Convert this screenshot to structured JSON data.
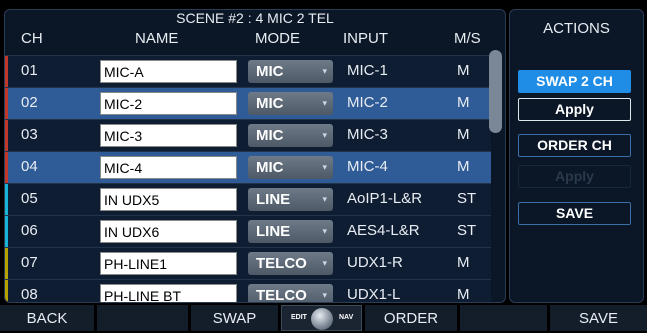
{
  "scene": {
    "title": "SCENE #2 : 4 MIC 2 TEL"
  },
  "columns": {
    "ch": "CH",
    "name": "NAME",
    "mode": "MODE",
    "input": "INPUT",
    "ms": "M/S"
  },
  "rows": [
    {
      "ch": "01",
      "name": "MIC-A",
      "mode": "MIC",
      "input": "MIC-1",
      "ms": "M",
      "selected": false,
      "stripe": "#c0392b"
    },
    {
      "ch": "02",
      "name": "MIC-2",
      "mode": "MIC",
      "input": "MIC-2",
      "ms": "M",
      "selected": true,
      "stripe": "#c0392b"
    },
    {
      "ch": "03",
      "name": "MIC-3",
      "mode": "MIC",
      "input": "MIC-3",
      "ms": "M",
      "selected": false,
      "stripe": "#c0392b"
    },
    {
      "ch": "04",
      "name": "MIC-4",
      "mode": "MIC",
      "input": "MIC-4",
      "ms": "M",
      "selected": true,
      "stripe": "#c0392b"
    },
    {
      "ch": "05",
      "name": "IN UDX5",
      "mode": "LINE",
      "input": "AoIP1-L&R",
      "ms": "ST",
      "selected": false,
      "stripe": "#17b3d6"
    },
    {
      "ch": "06",
      "name": "IN UDX6",
      "mode": "LINE",
      "input": "AES4-L&R",
      "ms": "ST",
      "selected": false,
      "stripe": "#17b3d6"
    },
    {
      "ch": "07",
      "name": "PH-LINE1",
      "mode": "TELCO",
      "input": "UDX1-R",
      "ms": "M",
      "selected": false,
      "stripe": "#b7a300"
    },
    {
      "ch": "08",
      "name": "PH-LINE BT",
      "mode": "TELCO",
      "input": "UDX1-L",
      "ms": "M",
      "selected": false,
      "stripe": "#b7a300"
    }
  ],
  "actions": {
    "title": "ACTIONS",
    "swap": "SWAP 2 CH",
    "apply1": "Apply",
    "order": "ORDER CH",
    "apply2": "Apply",
    "save": "SAVE"
  },
  "bottom": {
    "back": "BACK",
    "swap": "SWAP",
    "edit": "EDIT",
    "nav": "NAV",
    "order": "ORDER",
    "save": "SAVE"
  },
  "icons": {
    "mode_caret": "chevron-down-icon",
    "knob": "nav-knob-icon"
  },
  "colors": {
    "selected_row": "#2f5c96",
    "primary_button": "#1f8de6"
  }
}
